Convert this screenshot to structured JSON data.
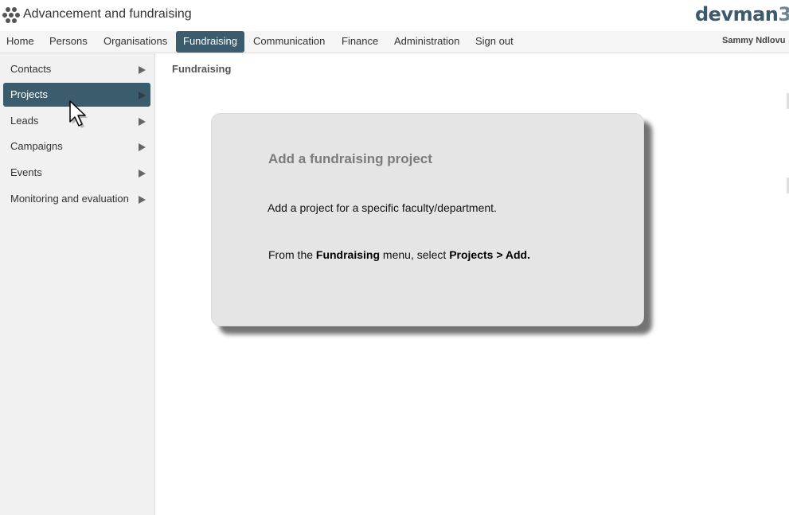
{
  "header": {
    "app_title": "Advancement and fundraising",
    "brand_main": "devman",
    "brand_num": "3"
  },
  "nav": {
    "items": [
      {
        "label": "Home"
      },
      {
        "label": "Persons"
      },
      {
        "label": "Organisations"
      },
      {
        "label": "Fundraising",
        "active": true
      },
      {
        "label": "Communication"
      },
      {
        "label": "Finance"
      },
      {
        "label": "Administration"
      },
      {
        "label": "Sign out"
      }
    ],
    "user_name": "Sammy Ndlovu"
  },
  "sidebar": {
    "items": [
      {
        "label": "Contacts"
      },
      {
        "label": "Projects",
        "active": true
      },
      {
        "label": "Leads"
      },
      {
        "label": "Campaigns"
      },
      {
        "label": "Events"
      },
      {
        "label": "Monitoring and evaluation"
      }
    ]
  },
  "main": {
    "section_title": "Fundraising",
    "card": {
      "title": "Add a fundraising project",
      "description": "Add a project for a specific faculty/department.",
      "instruction_prefix": "From the ",
      "instruction_menu": "Fundraising",
      "instruction_middle": " menu, select ",
      "instruction_path": "Projects > Add."
    }
  },
  "colors": {
    "accent": "#3a5c6c",
    "brand": "#3b5a6e",
    "card_bg": "#e5e5e5"
  },
  "icons": {
    "app_logo": "dots-cluster-icon",
    "submenu_arrow": "triangle-right-icon",
    "cursor": "mouse-pointer-icon"
  }
}
